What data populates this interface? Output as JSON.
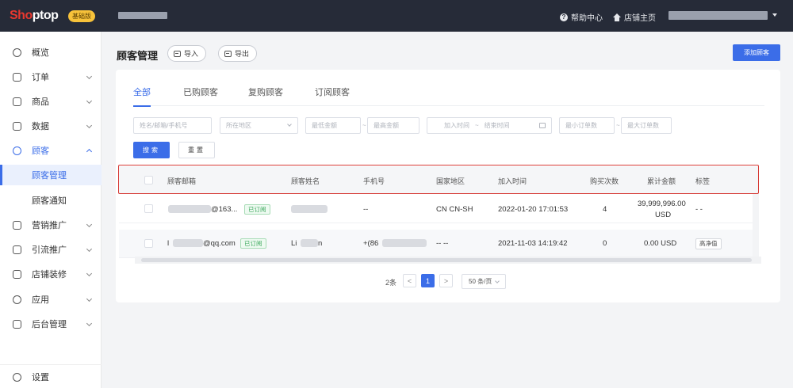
{
  "topbar": {
    "logo_a": "Sho",
    "logo_b": "ptop",
    "edition": "基础版",
    "help": "帮助中心",
    "help_icon": "?",
    "store_home": "店铺主页"
  },
  "sidebar": {
    "items": [
      {
        "label": "概览",
        "icon": "dashboard-icon"
      },
      {
        "label": "订单",
        "icon": "order-icon"
      },
      {
        "label": "商品",
        "icon": "product-icon"
      },
      {
        "label": "数据",
        "icon": "data-icon"
      },
      {
        "label": "顾客",
        "icon": "customer-icon"
      },
      {
        "label": "营销推广",
        "icon": "marketing-icon"
      },
      {
        "label": "引流推广",
        "icon": "traffic-icon"
      },
      {
        "label": "店铺装修",
        "icon": "decoration-icon"
      },
      {
        "label": "应用",
        "icon": "apps-icon"
      },
      {
        "label": "后台管理",
        "icon": "admin-icon"
      }
    ],
    "sub_items": [
      "顾客管理",
      "顾客通知"
    ],
    "settings": "设置"
  },
  "header": {
    "title": "顾客管理",
    "import": "导入",
    "export": "导出",
    "add_customer": "添加顾客"
  },
  "tabs": [
    "全部",
    "已购顾客",
    "复购顾客",
    "订阅顾客"
  ],
  "filters": {
    "name_placeholder": "姓名/邮箱/手机号",
    "region_placeholder": "所在地区",
    "min_amount": "最低金额",
    "max_amount": "最高金额",
    "join_time": "加入时间",
    "end_time": "结束时间",
    "min_orders": "最小订单数",
    "max_orders": "最大订单数",
    "tilde": "~",
    "search": "搜索",
    "reset": "重置"
  },
  "table": {
    "columns": [
      "顾客邮箱",
      "顾客姓名",
      "手机号",
      "国家地区",
      "加入时间",
      "购买次数",
      "累计金额",
      "标签"
    ],
    "rows": [
      {
        "email": "@163...",
        "tag": "已订阅",
        "name": "",
        "phone": "--",
        "region": "CN CN-SH",
        "join_time": "2022-01-20 17:01:53",
        "purchases": "4",
        "amount_line1": "39,999,996.00",
        "amount_line2": "USD",
        "label": "- -"
      },
      {
        "email_prefix": "l",
        "email": "@qq.com",
        "tag": "已订阅",
        "name_prefix": "Li",
        "name_suffix": "n",
        "phone": "+(86",
        "region": "-- --",
        "join_time": "2021-11-03 14:19:42",
        "purchases": "0",
        "amount_line1": "0.00 USD",
        "label": "高净值"
      }
    ]
  },
  "pagination": {
    "total": "2条",
    "current": "1",
    "prev": "<",
    "next": ">",
    "page_size": "50 条/页"
  }
}
